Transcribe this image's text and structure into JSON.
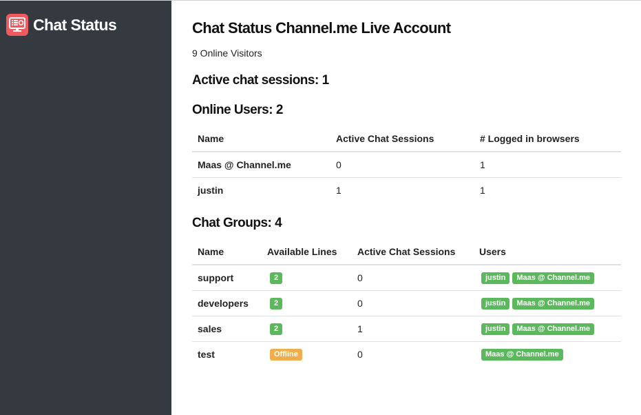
{
  "brand": {
    "name": "Chat Status",
    "icon": "monitor-chat-icon",
    "accent": "#f05a5f"
  },
  "sidebar": {
    "background": "#343a40"
  },
  "page": {
    "title": "Chat Status Channel.me Live Account",
    "visitors": "9 Online Visitors",
    "active_sessions": "Active chat sessions: 1"
  },
  "online_users": {
    "heading": "Online Users: 2",
    "columns": [
      "Name",
      "Active Chat Sessions",
      "# Logged in browsers"
    ],
    "rows": [
      {
        "name": "Maas @ Channel.me",
        "sessions": "0",
        "browsers": "1"
      },
      {
        "name": "justin",
        "sessions": "1",
        "browsers": "1"
      }
    ]
  },
  "chat_groups": {
    "heading": "Chat Groups: 4",
    "columns": [
      "Name",
      "Available Lines",
      "Active Chat Sessions",
      "Users"
    ],
    "rows": [
      {
        "name": "support",
        "lines": "2",
        "sessions": "0",
        "users": [
          "justin",
          "Maas @ Channel.me"
        ]
      },
      {
        "name": "developers",
        "lines": "2",
        "sessions": "0",
        "users": [
          "justin",
          "Maas @ Channel.me"
        ]
      },
      {
        "name": "sales",
        "lines": "2",
        "sessions": "1",
        "users": [
          "justin",
          "Maas @ Channel.me"
        ]
      },
      {
        "name": "test",
        "lines": "Offline",
        "sessions": "0",
        "users": [
          "Maas @ Channel.me"
        ]
      }
    ]
  },
  "colors": {
    "badge_green": "#5cb85c",
    "badge_orange": "#f0ad4e"
  }
}
